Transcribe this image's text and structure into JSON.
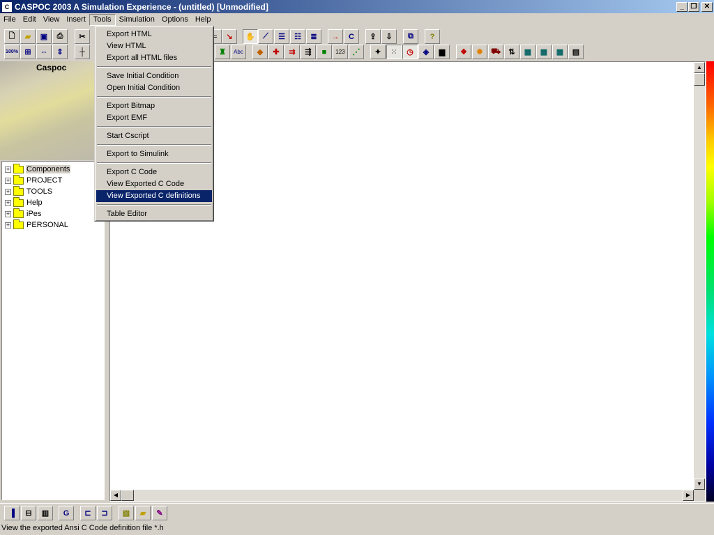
{
  "window": {
    "title": "CASPOC 2003 A Simulation Experience - (untitled) [Unmodified]",
    "app_icon": "caspoc-app-icon"
  },
  "menubar": {
    "items": [
      "File",
      "Edit",
      "View",
      "Insert",
      "Tools",
      "Simulation",
      "Options",
      "Help"
    ],
    "active": "Tools"
  },
  "tools_menu": {
    "items": [
      "Export HTML",
      "View HTML",
      "Export all HTML files",
      "Save Initial Condition",
      "Open Initial Condition",
      "Export Bitmap",
      "Export EMF",
      "Start Cscript",
      "Export to Simulink",
      "Export C Code",
      "View Exported C Code",
      "View Exported C definitions",
      "Table Editor"
    ],
    "highlighted": "View Exported C definitions"
  },
  "banner": {
    "brand": "Caspoc"
  },
  "tree": {
    "items": [
      "Components",
      "PROJECT",
      "TOOLS",
      "Help",
      "iPes",
      "PERSONAL"
    ],
    "selected": "Components"
  },
  "toolbar_left": {
    "zoom_label": "100%",
    "icons": [
      "new-file-icon",
      "open-folder-icon",
      "save-icon",
      "print-icon",
      "cut-icon",
      "zoom-100-icon",
      "zoom-fit-icon",
      "zoom-width-icon",
      "zoom-height-icon",
      "crosshair-icon"
    ]
  },
  "toolbar_main": {
    "row1_icons": [
      "line-icon",
      "pan-hand-icon",
      "graph-icon",
      "list-icon",
      "list-alt-icon",
      "list-edit-icon",
      "arrow-in-icon",
      "arrow-c-icon",
      "export-icon",
      "import-icon",
      "network-icon",
      "help-icon"
    ],
    "row2_icons": [
      "brush-icon",
      "text-abc-icon",
      "color-icon",
      "node-icon",
      "wire-icon",
      "bus-icon",
      "block-icon",
      "counter-123-icon",
      "probe-icon",
      "junction-icon",
      "grid-icon",
      "clock-icon",
      "fill-icon",
      "scope-icon",
      "component-icon",
      "fire-icon",
      "drive-icon",
      "sort-icon",
      "chip-icon",
      "chip2-icon",
      "chip3-icon",
      "table-icon"
    ],
    "abc_label": "Abc",
    "counter_label": "123"
  },
  "bottom_toolbar": {
    "icons": [
      "component-lib-icon",
      "tree-view-icon",
      "chip-view-icon",
      "refresh-g-icon",
      "hierarchy-icon",
      "hierarchy2-icon",
      "image-icon",
      "folder-image-icon",
      "paint-icon"
    ]
  },
  "statusbar": {
    "text": "View the exported Ansi C Code definition file *.h"
  }
}
